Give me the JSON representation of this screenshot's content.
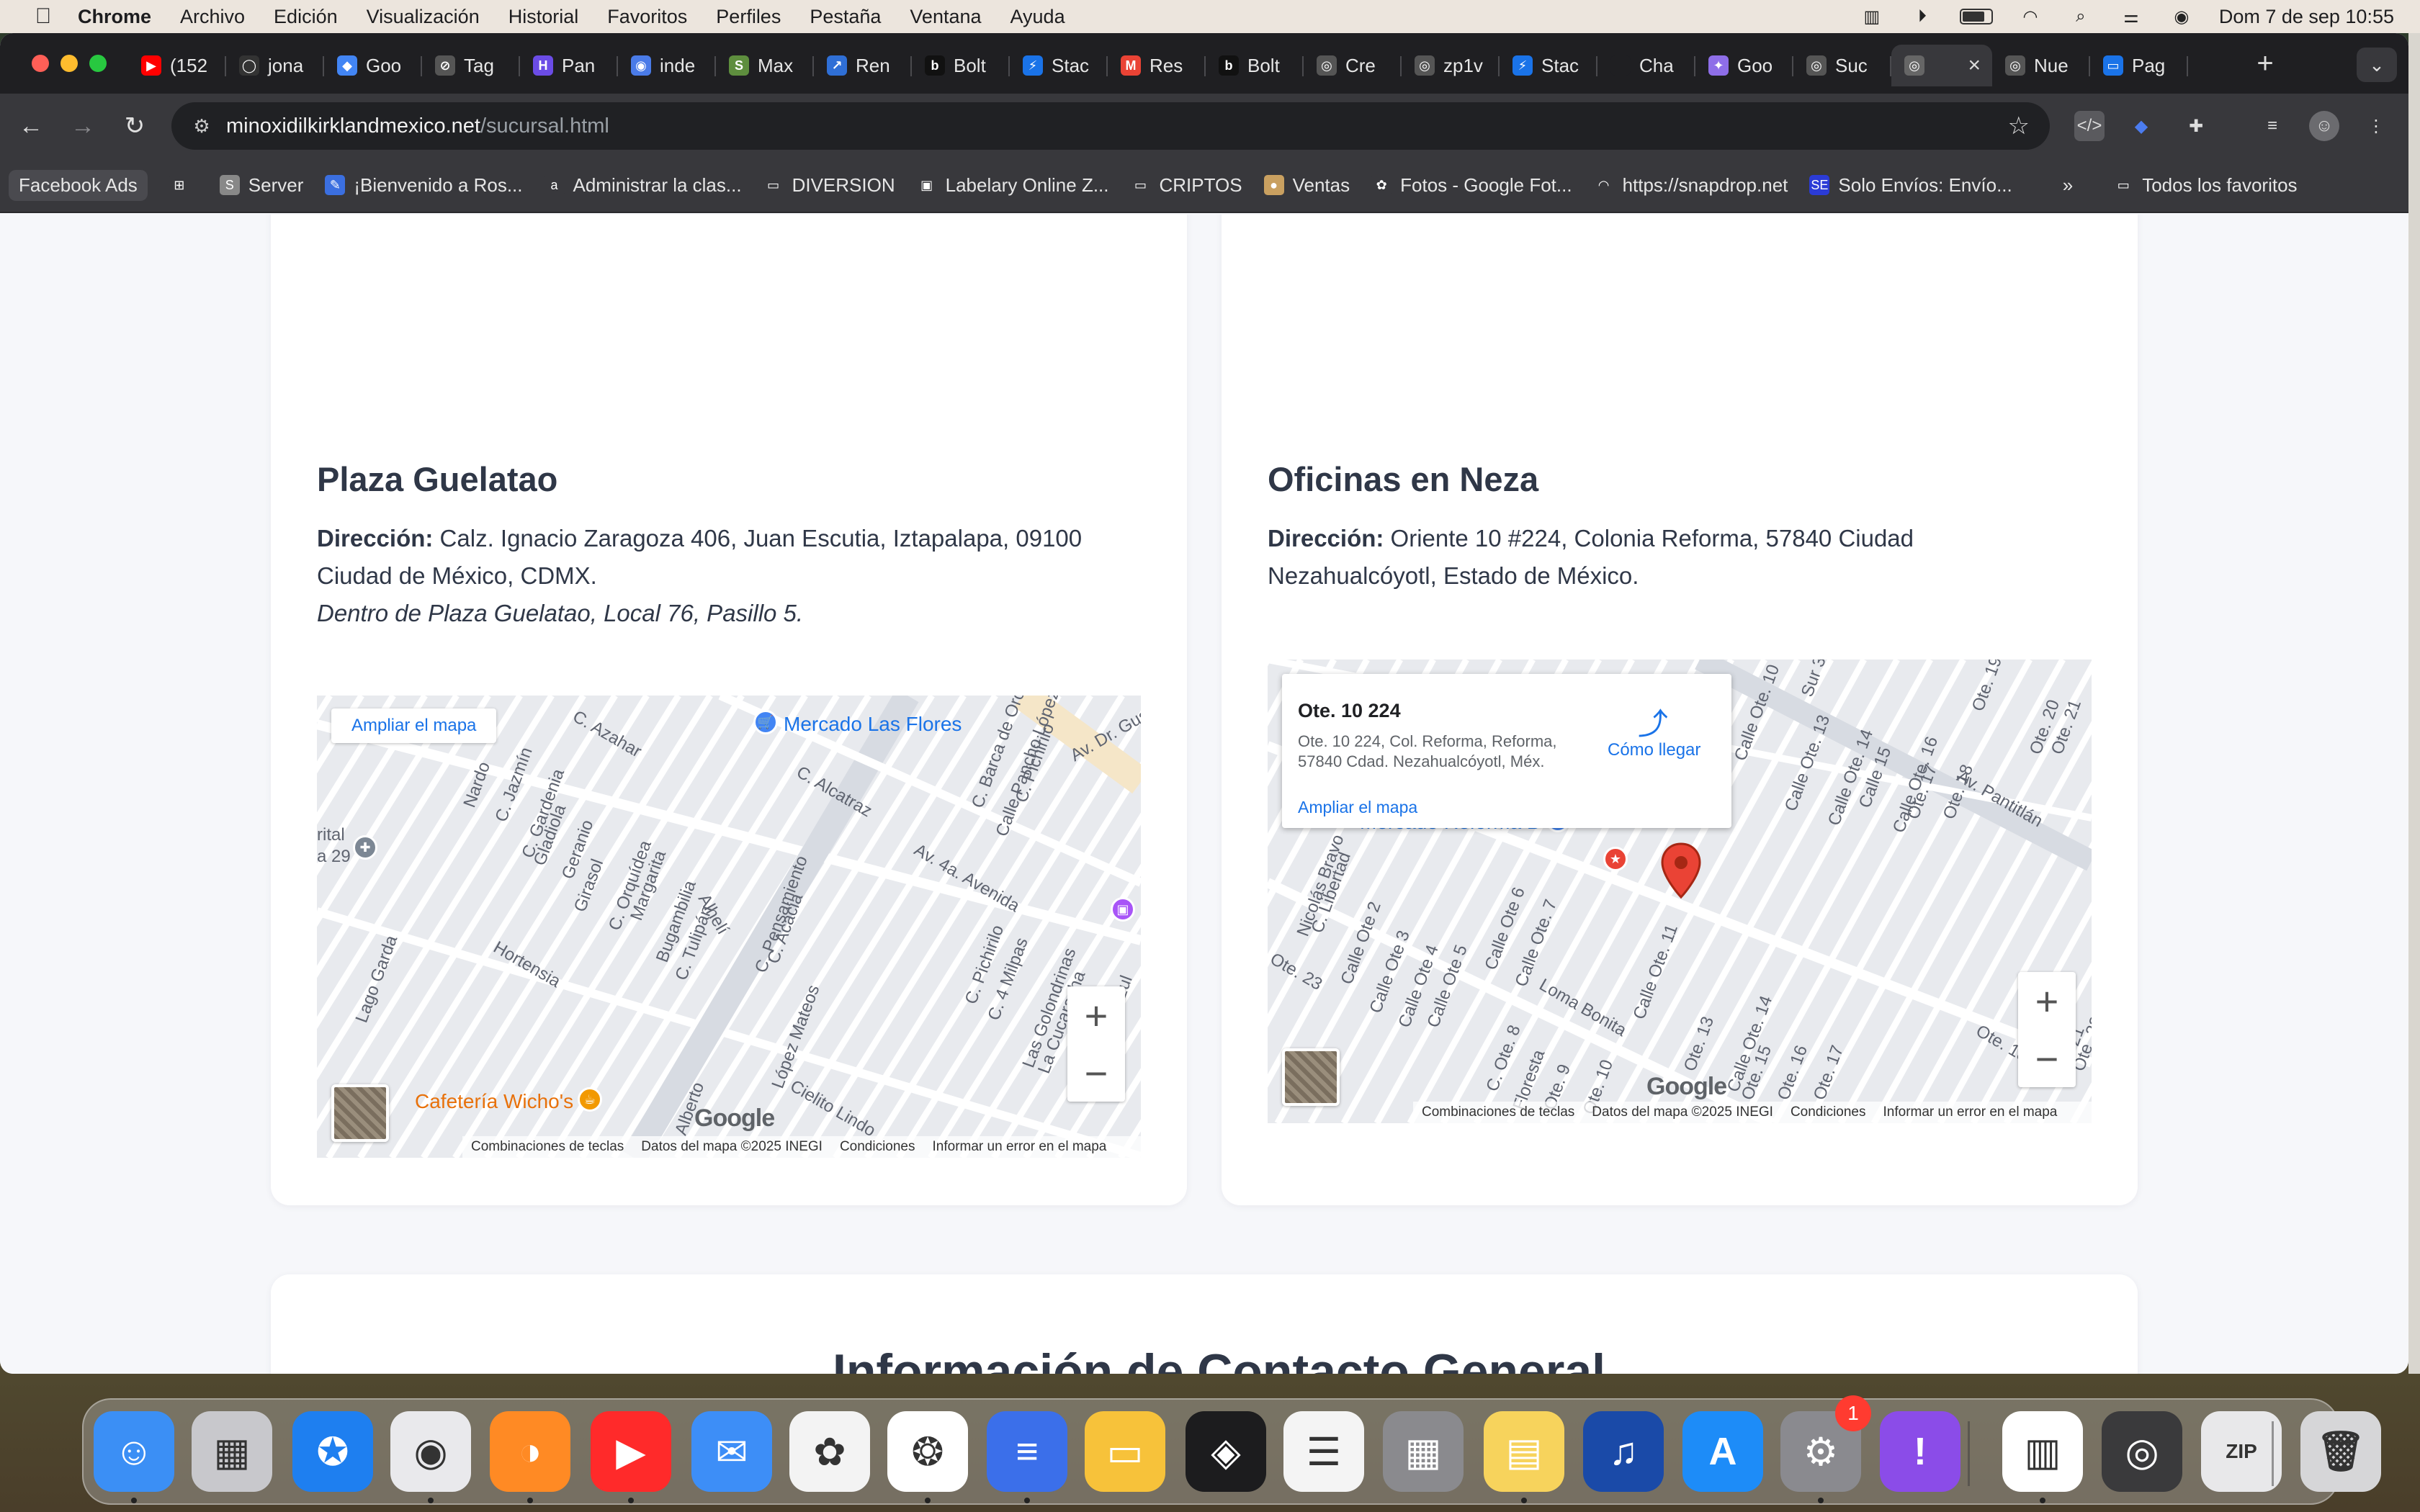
{
  "menubar": {
    "items": [
      "Chrome",
      "Archivo",
      "Edición",
      "Visualización",
      "Historial",
      "Favoritos",
      "Perfiles",
      "Pestaña",
      "Ventana",
      "Ayuda"
    ],
    "clock": "Dom 7 de sep  10:55"
  },
  "tabs": [
    {
      "label": "(152",
      "color": "#ff0000",
      "glyph": "▶"
    },
    {
      "label": "jona",
      "color": "#333333",
      "glyph": "◯"
    },
    {
      "label": "Goo",
      "color": "#4285f4",
      "glyph": "◆"
    },
    {
      "label": "Tag",
      "color": "#555555",
      "glyph": "⊘"
    },
    {
      "label": "Pan",
      "color": "#6b4ce6",
      "glyph": "H"
    },
    {
      "label": "inde",
      "color": "#4a7be8",
      "glyph": "◉"
    },
    {
      "label": "Max",
      "color": "#5e8e3e",
      "glyph": "S"
    },
    {
      "label": "Ren",
      "color": "#2f6fd6",
      "glyph": "↗"
    },
    {
      "label": "Bolt",
      "color": "#111111",
      "glyph": "b"
    },
    {
      "label": "Stac",
      "color": "#1a73e8",
      "glyph": "⚡"
    },
    {
      "label": "Res",
      "color": "#ea4335",
      "glyph": "M"
    },
    {
      "label": "Bolt",
      "color": "#111111",
      "glyph": "b"
    },
    {
      "label": "Cre",
      "color": "#555555",
      "glyph": "◎"
    },
    {
      "label": "zp1v",
      "color": "#555555",
      "glyph": "◎"
    },
    {
      "label": "Stac",
      "color": "#1a73e8",
      "glyph": "⚡"
    },
    {
      "label": "Cha",
      "color": "#1f1f22",
      "glyph": ""
    },
    {
      "label": "Goo",
      "color": "#8e6ee8",
      "glyph": "✦"
    },
    {
      "label": "Suc",
      "color": "#555555",
      "glyph": "◎"
    },
    {
      "label": "",
      "color": "#666666",
      "glyph": "◎",
      "active": true
    },
    {
      "label": "Nue",
      "color": "#555555",
      "glyph": "◎"
    },
    {
      "label": "Pag",
      "color": "#1a73e8",
      "glyph": "▭"
    }
  ],
  "omnibox": {
    "domain": "minoxidilkirklandmexico.net",
    "path": "/sucursal.html"
  },
  "bookmarks": [
    {
      "label": "Facebook Ads",
      "color": "#4a4a4f",
      "glyph": ""
    },
    {
      "label": "",
      "color": "#38383c",
      "glyph": "⊞"
    },
    {
      "label": "Server",
      "color": "#888888",
      "glyph": "S"
    },
    {
      "label": "¡Bienvenido a Ros...",
      "color": "#3b6fe0",
      "glyph": "✎"
    },
    {
      "label": "Administrar la clas...",
      "color": "#38383c",
      "glyph": "a"
    },
    {
      "label": "DIVERSION",
      "color": "#38383c",
      "glyph": "▭"
    },
    {
      "label": "Labelary Online Z...",
      "color": "#38383c",
      "glyph": "▣"
    },
    {
      "label": "CRIPTOS",
      "color": "#38383c",
      "glyph": "▭"
    },
    {
      "label": "Ventas",
      "color": "#c9a060",
      "glyph": "●"
    },
    {
      "label": "Fotos - Google Fot...",
      "color": "#38383c",
      "glyph": "✿"
    },
    {
      "label": "https://snapdrop.net",
      "color": "#38383c",
      "glyph": "◠"
    },
    {
      "label": "Solo Envíos: Envío...",
      "color": "#2b3bd6",
      "glyph": "SE"
    }
  ],
  "bookmarks_more": "»",
  "bookmarks_all": "Todos los favoritos",
  "branches": [
    {
      "name": "Plaza Guelatao",
      "address_label": "Dirección:",
      "address": "Calz. Ignacio Zaragoza 406, Juan Escutia, Iztapalapa, 09100 Ciudad de México, CDMX.",
      "note": "Dentro de Plaza Guelatao, Local 76, Pasillo 5.",
      "map": {
        "expand_link": "Ampliar el mapa",
        "labels": [
          "C. Azahar",
          "Nardo",
          "C. Jazmín",
          "C. Gardenia",
          "Gladiola",
          "Geranio",
          "Girasol",
          "C. Orquídea",
          "Margarita",
          "Bugambilia",
          "C. Tulipán",
          "Alhelí",
          "C. Pensamiento",
          "C. Acacia",
          "Hortensia",
          "Lago Garda",
          "C. Alcatraz",
          "Av. 4a. Avenida",
          "C. Barca de Oro",
          "Calle Pancho López",
          "C. Pichirilo",
          "Av. Dr. Gust",
          "C. Pichirilo",
          "C. 4 Milpas",
          "Las Golondrinas",
          "La Cucaracha",
          "Cl. Pájaro Azul",
          "López Mateos",
          "Cielito Lindo",
          "Alberto",
          "rital",
          "a 29"
        ],
        "pois": [
          "Mercado Las Flores",
          "Cafetería Wicho's"
        ],
        "footer": [
          "Combinaciones de teclas",
          "Datos del mapa ©2025 INEGI",
          "Condiciones",
          "Informar un error en el mapa"
        ],
        "zoom_in": "+",
        "zoom_out": "−"
      }
    },
    {
      "name": "Oficinas en Neza",
      "address_label": "Dirección:",
      "address": "Oriente 10 #224, Colonia Reforma, 57840 Ciudad Nezahualcóyotl, Estado de México.",
      "map": {
        "bubble_title": "Ote. 10 224",
        "bubble_address": "Ote. 10 224, Col. Reforma, Reforma, 57840 Cdad. Nezahualcóyotl, Méx.",
        "directions": "Cómo llegar",
        "expand_link": "Ampliar el mapa",
        "labels": [
          "Calle Ote. 10",
          "Calle Ote. 13",
          "Calle Ote. 14",
          "Calle 15",
          "Calle Ote. 16",
          "Ote. 17",
          "Ote. 18",
          "Ote. 19",
          "Ote. 20",
          "Ote. 21",
          "Av. Pantitlán",
          "Calle Ote 6",
          "Calle Ote. 7",
          "Calle Ote. 11",
          "Loma Bonita",
          "Calle Ote 2",
          "Calle Ote 3",
          "Calle Ote 4",
          "Calle Ote 5",
          "C. Libertad",
          "Nicolás Bravo",
          "C. Ote. 8",
          "Floresta",
          "Ote. 9",
          "Ote. 10",
          "Ote. 13",
          "Calle Ote. 14",
          "Ote. 15",
          "Ote. 16",
          "Ote. 17",
          "Ote. 18",
          "Sur 2",
          "Sur 21",
          "Ote. 22",
          "Ote. 23",
          "Sur 3",
          "Calle"
        ],
        "pois": [
          "Mercado Reforma B"
        ],
        "footer": [
          "Combinaciones de teclas",
          "Datos del mapa ©2025 INEGI",
          "Condiciones",
          "Informar un error en el mapa"
        ],
        "zoom_in": "+",
        "zoom_out": "−"
      }
    }
  ],
  "contact_title": "Información de Contacto General",
  "map_brand": "Google",
  "dock": {
    "apps": [
      {
        "name": "finder",
        "color": "#3b8ff5",
        "glyph": "☺"
      },
      {
        "name": "launchpad",
        "color": "#c8c8cc",
        "glyph": "▦"
      },
      {
        "name": "safari",
        "color": "#1e7ff0",
        "glyph": "✪"
      },
      {
        "name": "chrome",
        "color": "#e9e9ec",
        "glyph": "◉"
      },
      {
        "name": "firefox",
        "color": "#ff8a24",
        "glyph": "◑"
      },
      {
        "name": "youtube",
        "color": "#ff2a2a",
        "glyph": "▶"
      },
      {
        "name": "mail",
        "color": "#3d8ef7",
        "glyph": "✉"
      },
      {
        "name": "photos",
        "color": "#f3f3f3",
        "glyph": "✿"
      },
      {
        "name": "chatgpt",
        "color": "#ffffff",
        "glyph": "❂"
      },
      {
        "name": "docs",
        "color": "#3b6fea",
        "glyph": "≡"
      },
      {
        "name": "keynote",
        "color": "#f7c23a",
        "glyph": "▭"
      },
      {
        "name": "app-store-cube",
        "color": "#1c1c1e",
        "glyph": "◈"
      },
      {
        "name": "reminders",
        "color": "#f4f4f4",
        "glyph": "☰"
      },
      {
        "name": "calculator",
        "color": "#8a8a8e",
        "glyph": "▦"
      },
      {
        "name": "notes",
        "color": "#f7d35c",
        "glyph": "▤"
      },
      {
        "name": "audacity",
        "color": "#1a4aa8",
        "glyph": "♫"
      },
      {
        "name": "app-store",
        "color": "#1d8cf8",
        "glyph": "A"
      },
      {
        "name": "system-settings",
        "color": "#8a8a8f",
        "glyph": "⚙",
        "badge": "1"
      },
      {
        "name": "feedback",
        "color": "#8b4ce8",
        "glyph": "!"
      },
      {
        "name": "mac-barcode",
        "color": "#ffffff",
        "glyph": "▥"
      },
      {
        "name": "quicktime",
        "color": "#3a3a3c",
        "glyph": "◎"
      },
      {
        "name": "archive",
        "color": "#e8e8ea",
        "glyph": "ZIP"
      },
      {
        "name": "trash",
        "color": "#d6d6d8",
        "glyph": "🗑"
      }
    ]
  }
}
